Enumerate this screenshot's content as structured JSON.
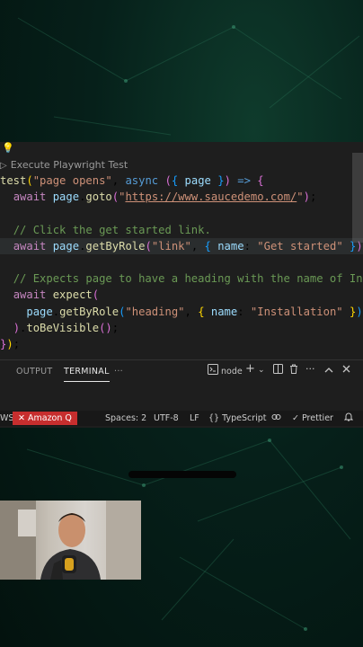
{
  "codelens": {
    "label": "Execute Playwright Test"
  },
  "code_lines": [
    {
      "parts": [
        [
          "fn",
          "test"
        ],
        [
          "brk",
          "("
        ],
        [
          "str",
          "\"page opens\""
        ],
        [
          "txt",
          ", "
        ],
        [
          "kw",
          "async"
        ],
        [
          "txt",
          " "
        ],
        [
          "brk2",
          "("
        ],
        [
          "brk3",
          "{"
        ],
        [
          "txt",
          " "
        ],
        [
          "var",
          "page"
        ],
        [
          "txt",
          " "
        ],
        [
          "brk3",
          "}"
        ],
        [
          "brk2",
          ")"
        ],
        [
          "txt",
          " "
        ],
        [
          "kw",
          "=>"
        ],
        [
          "txt",
          " "
        ],
        [
          "brk2",
          "{"
        ]
      ]
    },
    {
      "parts": [
        [
          "txt",
          "  "
        ],
        [
          "kw2",
          "await"
        ],
        [
          "txt",
          " "
        ],
        [
          "var",
          "page"
        ],
        [
          "txt",
          "."
        ],
        [
          "fn",
          "goto"
        ],
        [
          "brk2",
          "("
        ],
        [
          "str",
          "\""
        ],
        [
          "url",
          "https://www.saucedemo.com/"
        ],
        [
          "str",
          "\""
        ],
        [
          "brk2",
          ")"
        ],
        [
          "txt",
          ";"
        ]
      ]
    },
    {
      "parts": [
        [
          "txt",
          ""
        ]
      ]
    },
    {
      "parts": [
        [
          "txt",
          "  "
        ],
        [
          "com",
          "// Click the get started link."
        ]
      ]
    },
    {
      "parts": [
        [
          "txt",
          "  "
        ],
        [
          "kw2",
          "await"
        ],
        [
          "txt",
          " "
        ],
        [
          "var",
          "page"
        ],
        [
          "txt",
          "."
        ],
        [
          "fn",
          "getByRole"
        ],
        [
          "brk2",
          "("
        ],
        [
          "str",
          "\"link\""
        ],
        [
          "txt",
          ", "
        ],
        [
          "brk3",
          "{"
        ],
        [
          "txt",
          " "
        ],
        [
          "var",
          "name"
        ],
        [
          "txt",
          ": "
        ],
        [
          "str",
          "\"Get started\""
        ],
        [
          "txt",
          " "
        ],
        [
          "brk3",
          "}"
        ],
        [
          "brk2",
          ")"
        ],
        [
          "txt",
          "."
        ]
      ]
    },
    {
      "parts": [
        [
          "txt",
          ""
        ]
      ]
    },
    {
      "parts": [
        [
          "txt",
          "  "
        ],
        [
          "com",
          "// Expects page to have a heading with the name of Ins"
        ]
      ]
    },
    {
      "parts": [
        [
          "txt",
          "  "
        ],
        [
          "kw2",
          "await"
        ],
        [
          "txt",
          " "
        ],
        [
          "fn",
          "expect"
        ],
        [
          "brk2",
          "("
        ]
      ]
    },
    {
      "parts": [
        [
          "txt",
          "    "
        ],
        [
          "var",
          "page"
        ],
        [
          "txt",
          "."
        ],
        [
          "fn",
          "getByRole"
        ],
        [
          "brk3",
          "("
        ],
        [
          "str",
          "\"heading\""
        ],
        [
          "txt",
          ", "
        ],
        [
          "brk",
          "{"
        ],
        [
          "txt",
          " "
        ],
        [
          "var",
          "name"
        ],
        [
          "txt",
          ": "
        ],
        [
          "str",
          "\"Installation\""
        ],
        [
          "txt",
          " "
        ],
        [
          "brk",
          "}"
        ],
        [
          "brk3",
          ")"
        ]
      ]
    },
    {
      "parts": [
        [
          "txt",
          "  "
        ],
        [
          "brk2",
          ")"
        ],
        [
          "txt",
          "."
        ],
        [
          "fn",
          "toBeVisible"
        ],
        [
          "brk2",
          "()"
        ],
        [
          "txt",
          ";"
        ]
      ]
    },
    {
      "parts": [
        [
          "brk2",
          "}"
        ],
        [
          "brk",
          ")"
        ],
        [
          "txt",
          ";"
        ]
      ]
    }
  ],
  "panel": {
    "tabs": [
      "OUTPUT",
      "TERMINAL"
    ],
    "active_tab": "TERMINAL",
    "more": "···",
    "terminal_name": "node",
    "icons": [
      "terminal-icon",
      "plus-icon",
      "chevron-down-icon",
      "split-icon",
      "trash-icon",
      "more-icon",
      "chevron-up-icon",
      "close-icon"
    ]
  },
  "statusbar": {
    "left_fragment": "WS",
    "amazon_q": "Amazon Q",
    "spaces": "Spaces: 2",
    "encoding": "UTF-8",
    "eol": "LF",
    "language": "TypeScript",
    "prettier": "Prettier"
  },
  "colors": {
    "editor_bg": "#1e1e1e",
    "amazon_q_bg": "#c72e2e",
    "statusbar_bg": "#181818"
  }
}
